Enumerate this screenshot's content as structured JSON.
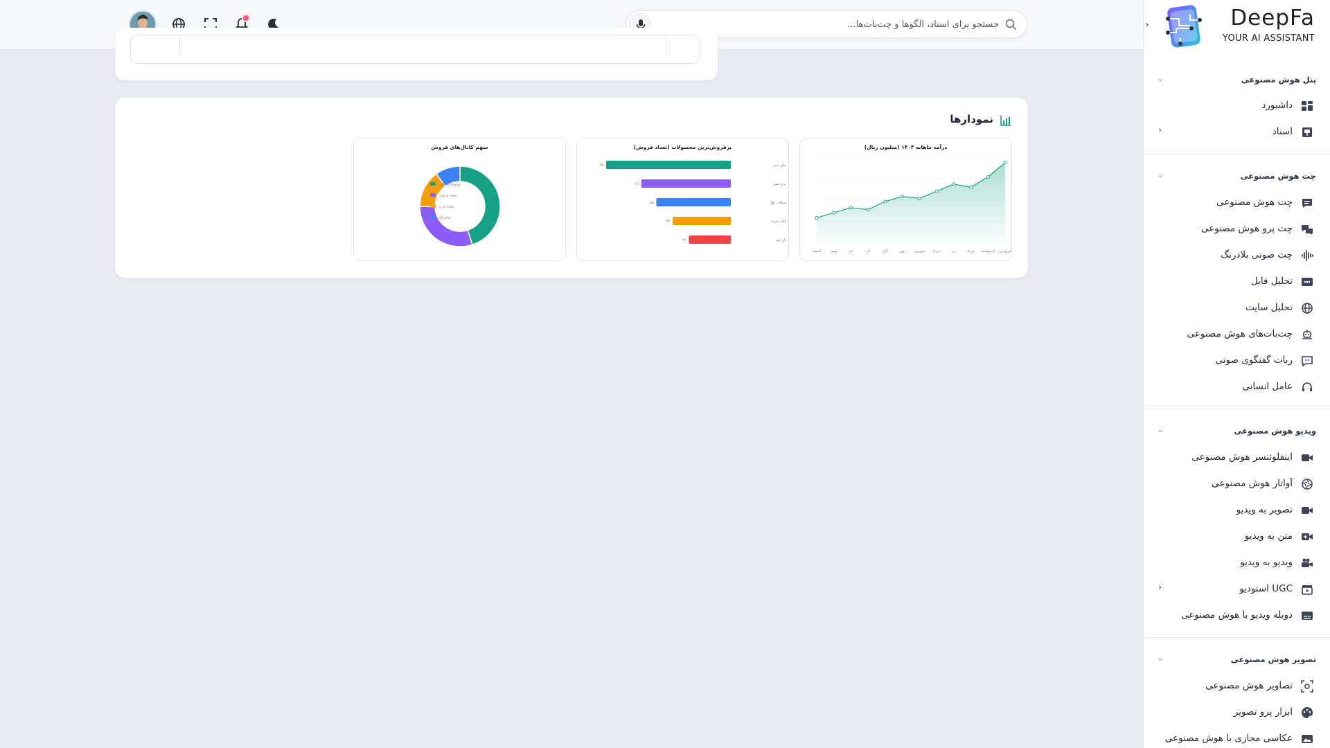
{
  "brand": {
    "name": "DeepFa",
    "tagline": "YOUR AI ASSISTANT",
    "colors": {
      "accent": "#16a085",
      "purple": "#8b5cf6",
      "blue": "#3b82f6"
    }
  },
  "topbar": {
    "search_placeholder": "جستجو برای اسناد، الگوها و چت‌بات‌ها...",
    "icons": [
      "search-icon",
      "microphone-icon",
      "moon-icon",
      "bell-icon",
      "fullscreen-icon",
      "globe-icon",
      "avatar"
    ]
  },
  "sidebar": {
    "sections": [
      {
        "title": "پنل هوش مصنوعی",
        "items": [
          {
            "label": "داشبورد",
            "icon": "dashboard-icon"
          },
          {
            "label": "اسناد",
            "icon": "book-icon",
            "has_submenu": true
          }
        ]
      },
      {
        "title": "چت هوش مصنوعی",
        "items": [
          {
            "label": "چت هوش مصنوعی",
            "icon": "chat-icon"
          },
          {
            "label": "چت پرو هوش مصنوعی",
            "icon": "chats-icon"
          },
          {
            "label": "چت صوتی بلادرنگ",
            "icon": "waveform-icon"
          },
          {
            "label": "تحلیل فایل",
            "icon": "file-icon"
          },
          {
            "label": "تحلیل سایت",
            "icon": "globe-icon"
          },
          {
            "label": "چت‌بات‌های هوش مصنوعی",
            "icon": "robot-icon"
          },
          {
            "label": "ربات گفتگوی صوتی",
            "icon": "message-bot-icon"
          },
          {
            "label": "عامل انسانی",
            "icon": "headset-icon"
          }
        ]
      },
      {
        "title": "ویدیو هوش مصنوعی",
        "items": [
          {
            "label": "اینفلوئنسر هوش مصنوعی",
            "icon": "camera-icon"
          },
          {
            "label": "آواتار هوش مصنوعی",
            "icon": "aperture-icon"
          },
          {
            "label": "تصویر به ویدیو",
            "icon": "video-icon"
          },
          {
            "label": "متن به ویدیو",
            "icon": "video-plus-icon"
          },
          {
            "label": "ویدیو به ویدیو",
            "icon": "video-camera-icon"
          },
          {
            "label": "استودیو UGC",
            "icon": "clapperboard-icon",
            "has_submenu": true
          },
          {
            "label": "دوبله ویدیو با هوش مصنوعی",
            "icon": "subtitles-icon"
          }
        ]
      },
      {
        "title": "تصویر هوش مصنوعی",
        "items": [
          {
            "label": "تصاویر هوش مصنوعی",
            "icon": "image-scan-icon"
          },
          {
            "label": "ابزار پرو تصویر",
            "icon": "palette-icon"
          },
          {
            "label": "عکاسی مجازی با هوش مصنوعی",
            "icon": "photo-icon"
          }
        ]
      }
    ]
  },
  "main": {
    "charts_section_title": "نمودارها",
    "charts": [
      {
        "title": "درآمد ماهانه ۱۴۰۳ (میلیون ریال)",
        "chart_data": {
          "type": "area",
          "categories": [
            "فروردین",
            "اردیبهشت",
            "خرداد",
            "تیر",
            "مرداد",
            "شهریور",
            "مهر",
            "آبان",
            "آذر",
            "دی",
            "بهمن",
            "اسفند"
          ],
          "values": [
            120,
            145,
            170,
            160,
            200,
            225,
            215,
            250,
            285,
            270,
            320,
            390
          ],
          "ylim": [
            0,
            420
          ],
          "color": "#16a085"
        }
      },
      {
        "title": "پرفروش‌ترین محصولات (تعداد فروش)",
        "chart_data": {
          "type": "bar",
          "orientation": "horizontal",
          "categories": [
            "چای سبز",
            "برنج سیر",
            "شکلات تلخ",
            "کیک شیره",
            "نان جو"
          ],
          "values": [
            920,
            660,
            550,
            430,
            310
          ],
          "value_labels": [
            "۹۲۰",
            "۶۶۰",
            "۵۵۰",
            "۴۳۰",
            "۳۱۰"
          ],
          "colors": [
            "#16a085",
            "#8b5cf6",
            "#3b82f6",
            "#f59e0b",
            "#ef4444"
          ]
        }
      },
      {
        "title": "سهم کانال‌های فروش",
        "chart_data": {
          "type": "pie",
          "style": "donut",
          "labels": [
            "فروشگاه آنلاین",
            "شعبه مرکزی",
            "شعبه غرب",
            "نمایندگی"
          ],
          "values": [
            45,
            30,
            15,
            10
          ],
          "colors": [
            "#16a085",
            "#8b5cf6",
            "#f59e0b",
            "#3b82f6"
          ],
          "legend": "left"
        }
      }
    ]
  }
}
